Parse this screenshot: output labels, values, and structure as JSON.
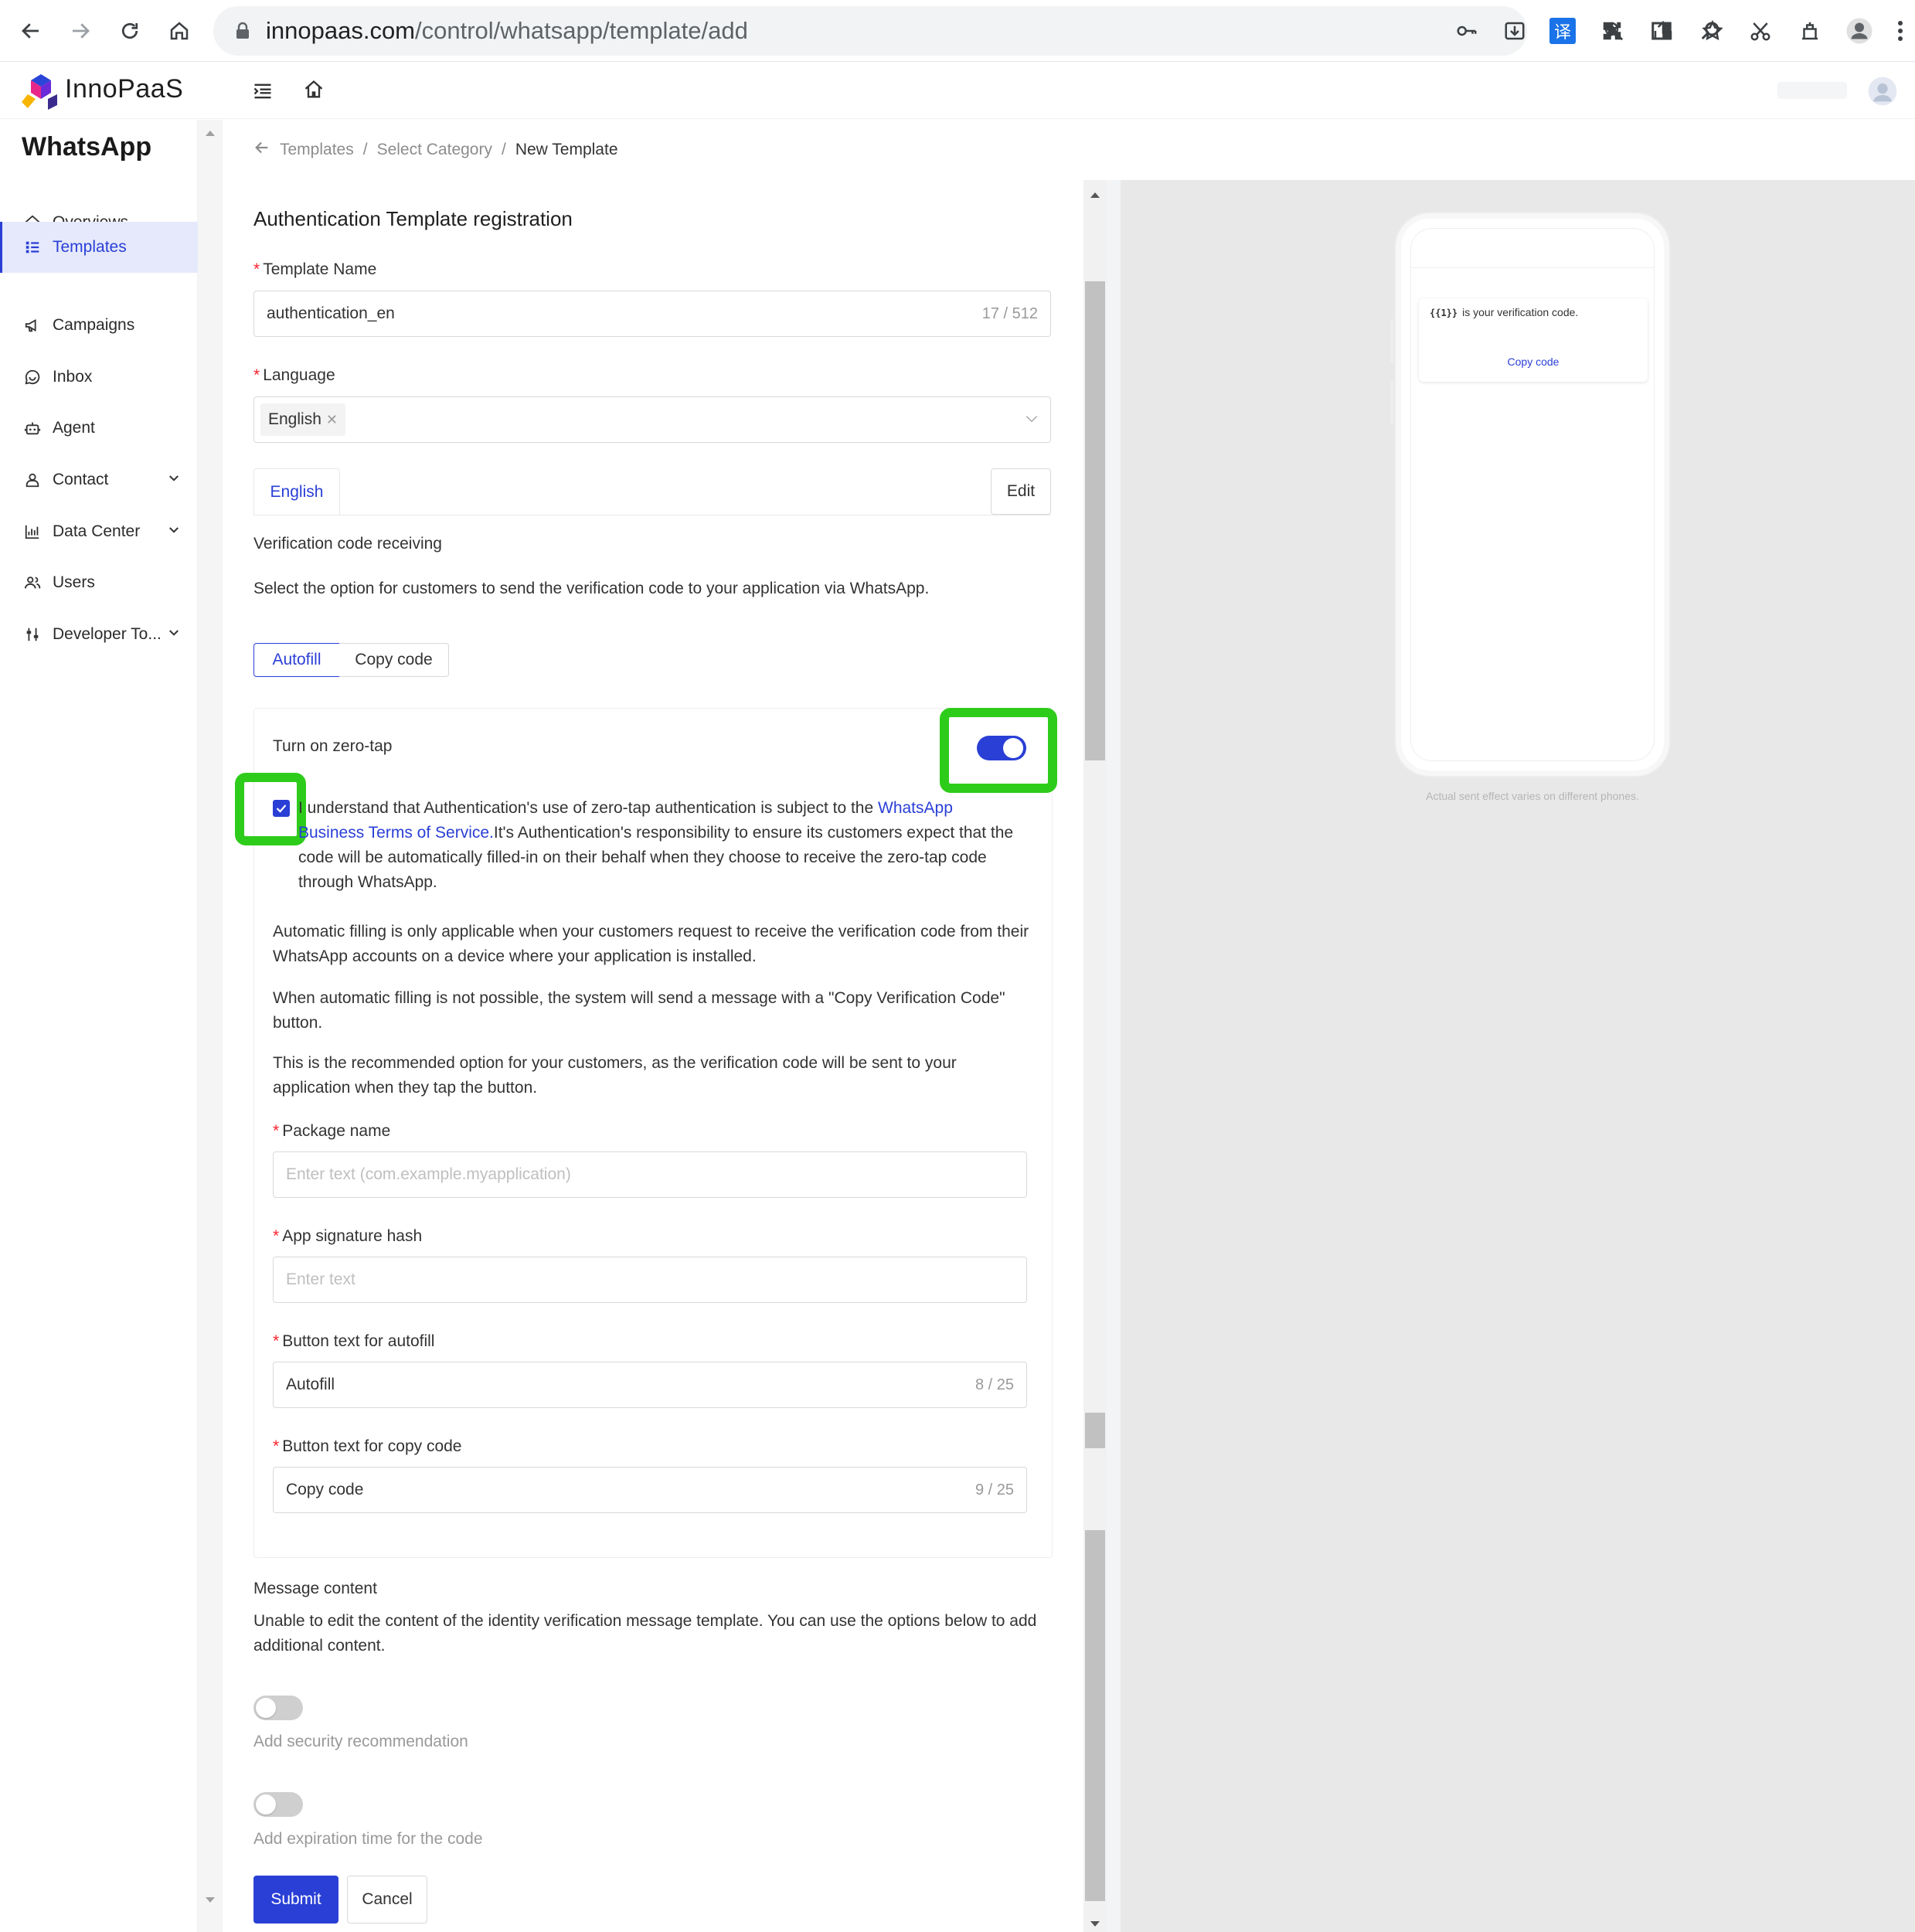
{
  "browser": {
    "url_host": "innopaas.com",
    "url_path": "/control/whatsapp/template/add",
    "translate_badge": "译"
  },
  "app": {
    "logo_text": "InnoPaaS"
  },
  "sidebar": {
    "title": "WhatsApp",
    "items": [
      {
        "label": "Overviews",
        "icon": "home-icon"
      },
      {
        "label": "Templates",
        "icon": "list-icon"
      },
      {
        "label": "Campaigns",
        "icon": "megaphone-icon"
      },
      {
        "label": "Inbox",
        "icon": "chat-icon"
      },
      {
        "label": "Agent",
        "icon": "robot-icon"
      },
      {
        "label": "Contact",
        "icon": "user-icon"
      },
      {
        "label": "Data Center",
        "icon": "chart-icon"
      },
      {
        "label": "Users",
        "icon": "users-icon"
      },
      {
        "label": "Developer To...",
        "icon": "tools-icon"
      }
    ]
  },
  "breadcrumb": {
    "items": [
      "Templates",
      "Select Category",
      "New Template"
    ],
    "separator": "/"
  },
  "form": {
    "title": "Authentication Template registration",
    "template_name": {
      "label": "Template Name",
      "value": "authentication_en",
      "count": "17 / 512"
    },
    "language": {
      "label": "Language",
      "tag": "English"
    },
    "language_tab": "English",
    "edit_button": "Edit",
    "verification_heading": "Verification code receiving",
    "verification_desc": "Select the option for customers to send the verification code to your application via WhatsApp.",
    "segments": {
      "autofill": "Autofill",
      "copy_code": "Copy code"
    },
    "zero_tap_label": "Turn on zero-tap",
    "consent_prefix": "I understand that Authentication's use of zero-tap authentication is subject to the ",
    "consent_link": "WhatsApp Business Terms of Service.",
    "consent_suffix": "It's Authentication's responsibility to ensure its customers expect that the code will be automatically filled-in on their behalf when they choose to receive the zero-tap code through WhatsApp.",
    "para1": "Automatic filling is only applicable when your customers request to receive the verification code from their WhatsApp accounts on a device where your application is installed.",
    "para2": "When automatic filling is not possible, the system will send a message with a \"Copy Verification Code\" button.",
    "para3": "This is the recommended option for your customers, as the verification code will be sent to your application when they tap the button.",
    "package_name": {
      "label": "Package name",
      "placeholder": "Enter text (com.example.myapplication)"
    },
    "app_hash": {
      "label": "App signature hash",
      "placeholder": "Enter text"
    },
    "autofill_text": {
      "label": "Button text for autofill",
      "value": "Autofill",
      "count": "8 / 25"
    },
    "copy_text": {
      "label": "Button text for copy code",
      "value": "Copy code",
      "count": "9 / 25"
    },
    "message_heading": "Message content",
    "message_desc": "Unable to edit the content of the identity verification message template. You can use the options below to add additional content.",
    "security_label": "Add security recommendation",
    "expiration_label": "Add expiration time for the code",
    "submit": "Submit",
    "cancel": "Cancel"
  },
  "preview": {
    "placeholder": "{{1}}",
    "message": "is your verification code.",
    "button": "Copy code",
    "note": "Actual sent effect varies on different phones."
  },
  "colors": {
    "primary": "#2a3fd6",
    "highlight": "#2ecc1a",
    "required": "#f5222d"
  }
}
